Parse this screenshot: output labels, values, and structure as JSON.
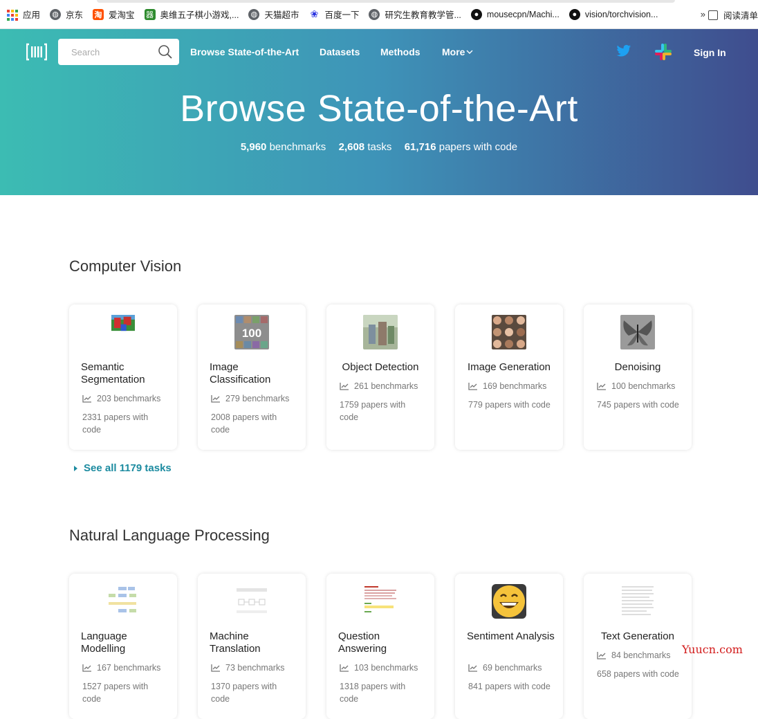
{
  "bookmarks": [
    {
      "label": "应用",
      "icon": "apps-icon"
    },
    {
      "label": "京东",
      "icon": "globe-icon"
    },
    {
      "label": "爱淘宝",
      "icon": "taobao-icon"
    },
    {
      "label": "奥维五子棋小游戏,...",
      "icon": "game-icon"
    },
    {
      "label": "天猫超市",
      "icon": "globe-icon"
    },
    {
      "label": "百度一下",
      "icon": "baidu-paw-icon"
    },
    {
      "label": "研究生教育教学管...",
      "icon": "globe-icon"
    },
    {
      "label": "mousecpn/Machi...",
      "icon": "github-icon"
    },
    {
      "label": "vision/torchvision...",
      "icon": "github-icon"
    }
  ],
  "bookmarks_more": "»",
  "reading_list": "阅读清单",
  "nav": {
    "search_placeholder": "Search",
    "links": [
      "Browse State-of-the-Art",
      "Datasets",
      "Methods",
      "More"
    ],
    "signin": "Sign In"
  },
  "hero": {
    "title": "Browse State-of-the-Art",
    "stats": [
      {
        "value": "5,960",
        "label": "benchmarks"
      },
      {
        "value": "2,608",
        "label": "tasks"
      },
      {
        "value": "61,716",
        "label": "papers with code"
      }
    ]
  },
  "sections": [
    {
      "title": "Computer Vision",
      "see_all": "See all 1179 tasks",
      "cards": [
        {
          "title": "Semantic Segmentation",
          "benchmarks": "203 benchmarks",
          "papers": "2331 papers with code"
        },
        {
          "title": "Image Classification",
          "benchmarks": "279 benchmarks",
          "papers": "2008 papers with code"
        },
        {
          "title": "Object Detection",
          "benchmarks": "261 benchmarks",
          "papers": "1759 papers with code"
        },
        {
          "title": "Image Generation",
          "benchmarks": "169 benchmarks",
          "papers": "779 papers with code"
        },
        {
          "title": "Denoising",
          "benchmarks": "100 benchmarks",
          "papers": "745 papers with code"
        }
      ]
    },
    {
      "title": "Natural Language Processing",
      "cards": [
        {
          "title": "Language Modelling",
          "benchmarks": "167 benchmarks",
          "papers": "1527 papers with code"
        },
        {
          "title": "Machine Translation",
          "benchmarks": "73 benchmarks",
          "papers": "1370 papers with code"
        },
        {
          "title": "Question Answering",
          "benchmarks": "103 benchmarks",
          "papers": "1318 papers with code"
        },
        {
          "title": "Sentiment Analysis",
          "benchmarks": "69 benchmarks",
          "papers": "841 papers with code"
        },
        {
          "title": "Text Generation",
          "benchmarks": "84 benchmarks",
          "papers": "658 papers with code"
        }
      ]
    }
  ],
  "thumb_text": {
    "image_classification": "100"
  },
  "watermark": "Yuucn.com",
  "colors": {
    "accent": "#1c8ba0",
    "hero_start": "#3cbcb3",
    "hero_end": "#3f4d8e"
  }
}
